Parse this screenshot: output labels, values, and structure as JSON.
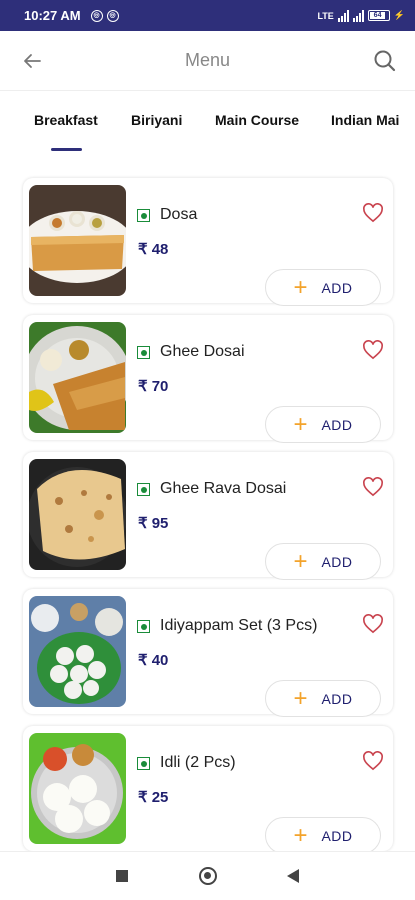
{
  "status_bar": {
    "time": "10:27 AM",
    "battery": "64",
    "network_label": "LTE"
  },
  "header": {
    "title": "Menu",
    "back_icon": "arrow-left-icon",
    "search_icon": "search-icon"
  },
  "tabs": [
    {
      "label": "Breakfast",
      "active": true
    },
    {
      "label": "Biriyani",
      "active": false
    },
    {
      "label": "Main Course",
      "active": false
    },
    {
      "label": "Indian Mai",
      "active": false
    }
  ],
  "items": [
    {
      "name": "Dosa",
      "price": "₹ 48",
      "add_label": "ADD"
    },
    {
      "name": "Ghee Dosai",
      "price": "₹ 70",
      "add_label": "ADD"
    },
    {
      "name": "Ghee Rava Dosai",
      "price": "₹ 95",
      "add_label": "ADD"
    },
    {
      "name": "Idiyappam Set (3 Pcs)",
      "price": "₹ 40",
      "add_label": "ADD"
    },
    {
      "name": "Idli (2 Pcs)",
      "price": "₹ 25",
      "add_label": "ADD"
    }
  ],
  "colors": {
    "status_bar": "#2e2f7a",
    "price": "#1f1f6e",
    "plus": "#f3a32b",
    "heart": "#c9444f",
    "veg": "#1a8c3a"
  }
}
